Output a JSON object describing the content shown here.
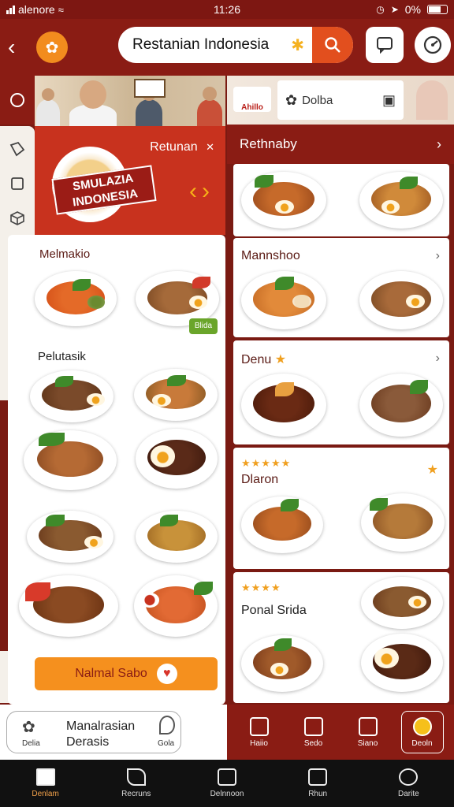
{
  "status": {
    "carrier": "alenore",
    "time": "11:26",
    "battery": "0%"
  },
  "header": {
    "search_value": "Restanian Indonesia"
  },
  "promo": {
    "title": "Retunan",
    "badge_line1": "SMULAZIA",
    "badge_line2": "INDONESIA"
  },
  "left": {
    "section1": "Melmakio",
    "section2": "Pelutasik",
    "tag": "Blida",
    "cta_label": "Nalmal Sabo"
  },
  "right": {
    "top_card": "Dolba",
    "logo_text": "Ahillo",
    "header": "Rethnaby",
    "card2_title": "Mannshoo",
    "card3_title": "Denu",
    "card4_title": "Dlaron",
    "card5_title": "Ponal Srida"
  },
  "bottom_left": {
    "line1": "Manalrasian",
    "line2": "Derasis",
    "left_label": "Delia",
    "right_label": "Gola"
  },
  "mini_tabs": [
    {
      "label": "Haiio"
    },
    {
      "label": "Sedo"
    },
    {
      "label": "Siano"
    },
    {
      "label": "Deoln"
    }
  ],
  "tabs": [
    {
      "label": "Denlam"
    },
    {
      "label": "Recruns"
    },
    {
      "label": "Delnnoon"
    },
    {
      "label": "Rhun"
    },
    {
      "label": "Darite"
    }
  ],
  "colors": {
    "brand": "#8a1c14",
    "accent": "#f5901e",
    "search_button": "#e24f1e"
  }
}
